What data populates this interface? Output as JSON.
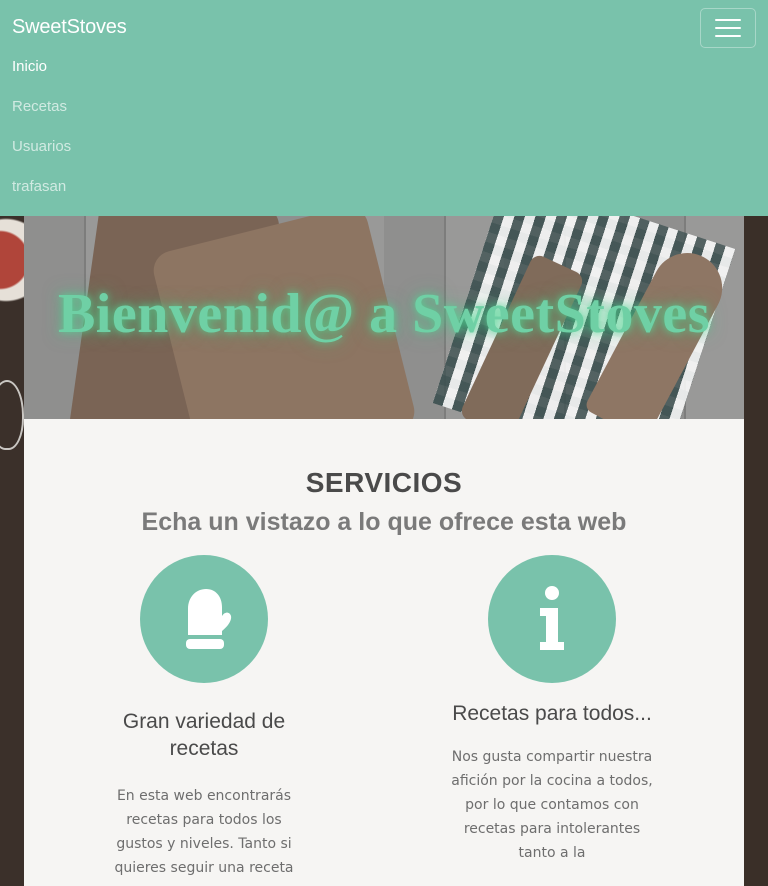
{
  "navbar": {
    "brand": "SweetStoves",
    "toggle_icon": "hamburger-menu-icon",
    "links": [
      {
        "label": "Inicio",
        "active": true
      },
      {
        "label": "Recetas",
        "active": false
      },
      {
        "label": "Usuarios",
        "active": false
      },
      {
        "label": "trafasan",
        "active": false
      }
    ],
    "background_color": "#79c2ab"
  },
  "hero": {
    "title": "Bienvenid@ a SweetStoves",
    "title_color": "#6fd0a5"
  },
  "services": {
    "title": "SERVICIOS",
    "subtitle": "Echa un vistazo a lo que ofrece esta web",
    "features": [
      {
        "icon": "oven-mitt-icon",
        "title": "Gran variedad de recetas",
        "text": "En esta web encontrarás recetas para todos los gustos y niveles. Tanto si quieres seguir una receta"
      },
      {
        "icon": "info-icon",
        "title": "Recetas para todos...",
        "text": "Nos gusta compartir nuestra afición por la cocina a todos, por lo que contamos con recetas para intolerantes tanto a la"
      }
    ],
    "accent_color": "#79c2ab"
  }
}
